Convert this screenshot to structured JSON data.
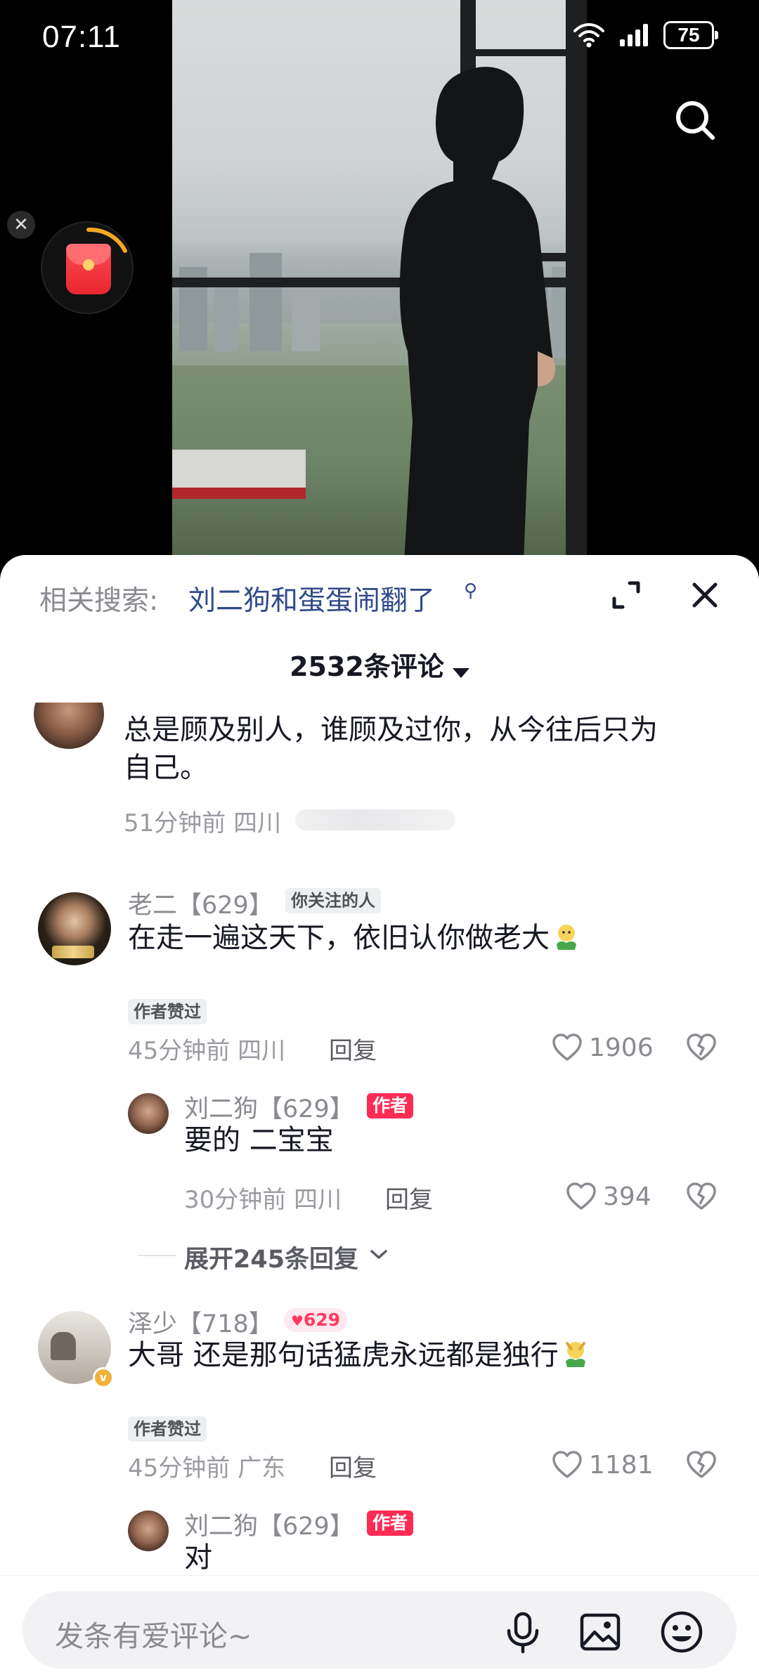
{
  "status_bar": {
    "time": "07:11",
    "battery": "75"
  },
  "sheet": {
    "related_prefix": "相关搜索:",
    "related_query": "刘二狗和蛋蛋闹翻了",
    "comment_count_label": "2532条评论"
  },
  "comments": [
    {
      "text_line1": "总是顾及别人，谁顾及过你，从今往后只为",
      "text_line2": "自己。",
      "meta": "51分钟前 四川"
    },
    {
      "name": "老二【629】",
      "follow_tag": "你关注的人",
      "text": "在走一遍这天下，依旧认你做老大",
      "author_liked_tag": "作者赞过",
      "meta": "45分钟前 四川",
      "reply_label": "回复",
      "likes": "1906",
      "reply": {
        "name": "刘二狗【629】",
        "author_tag": "作者",
        "text": "要的 二宝宝",
        "meta": "30分钟前 四川",
        "reply_label": "回复",
        "likes": "394"
      },
      "expand_label": "展开245条回复"
    },
    {
      "name": "泽少【718】",
      "fan_badge": "629",
      "text": "大哥 还是那句话猛虎永远都是独行",
      "author_liked_tag": "作者赞过",
      "meta": "45分钟前 广东",
      "reply_label": "回复",
      "likes": "1181",
      "reply": {
        "name": "刘二狗【629】",
        "author_tag": "作者",
        "text": "对"
      }
    }
  ],
  "input": {
    "placeholder": "发条有爱评论~"
  },
  "colors": {
    "accent": "#fe2c55",
    "related_link": "#2f4a8a",
    "secondary_text": "#8a8b91"
  },
  "icons": [
    "search-icon",
    "close-icon",
    "red-packet-icon",
    "expand-icon",
    "heart-icon",
    "dislike-heart-icon",
    "chevron-down-icon",
    "microphone-icon",
    "image-icon",
    "emoji-icon"
  ]
}
